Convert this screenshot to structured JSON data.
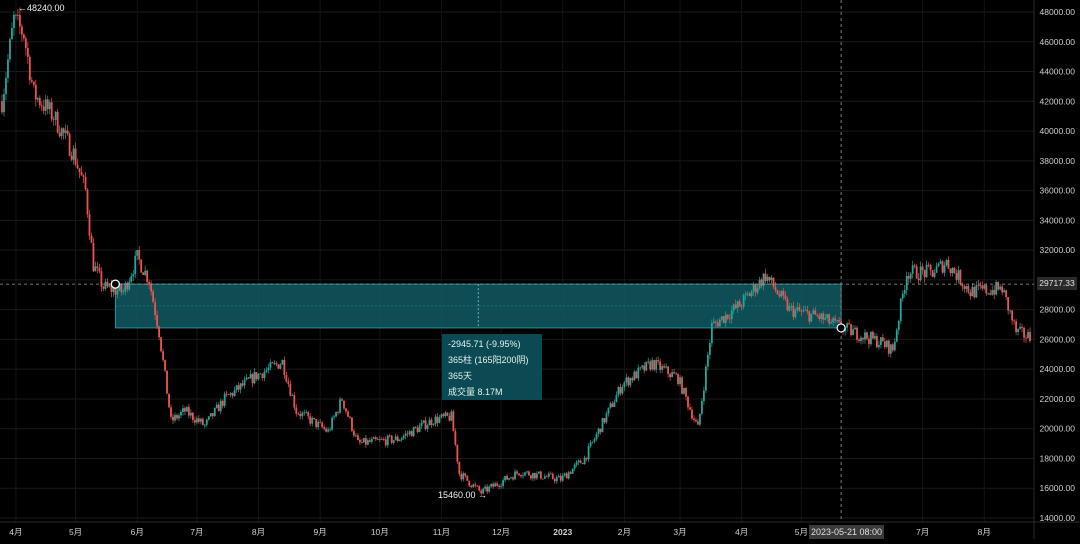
{
  "chart_data": {
    "type": "candlestick",
    "y_axis": {
      "ticks": [
        "48000.00",
        "46000.00",
        "44000.00",
        "42000.00",
        "40000.00",
        "38000.00",
        "36000.00",
        "34000.00",
        "32000.00",
        "30000.00",
        "28000.00",
        "26000.00",
        "24000.00",
        "22000.00",
        "20000.00",
        "18000.00",
        "16000.00",
        "14000.00"
      ],
      "range": [
        14000,
        48000
      ]
    },
    "x_axis": {
      "ticks": [
        "4月",
        "5月",
        "6月",
        "7月",
        "8月",
        "9月",
        "10月",
        "11月",
        "12月",
        "2023",
        "2月",
        "3月",
        "4月",
        "5月",
        "7月",
        "8月"
      ]
    },
    "series": [
      {
        "values_approx": [
          [
            "2022-03-25",
            42000
          ],
          [
            "2022-03-31",
            47500
          ],
          [
            "2022-04-05",
            46500
          ],
          [
            "2022-04-10",
            42500
          ],
          [
            "2022-04-20",
            41000
          ],
          [
            "2022-04-30",
            38500
          ],
          [
            "2022-05-06",
            36000
          ],
          [
            "2022-05-10",
            31000
          ],
          [
            "2022-05-15",
            29500
          ],
          [
            "2022-05-25",
            29200
          ],
          [
            "2022-06-01",
            31500
          ],
          [
            "2022-06-07",
            30000
          ],
          [
            "2022-06-12",
            26500
          ],
          [
            "2022-06-18",
            20500
          ],
          [
            "2022-06-25",
            21200
          ],
          [
            "2022-07-05",
            20200
          ],
          [
            "2022-07-15",
            22000
          ],
          [
            "2022-07-30",
            23500
          ],
          [
            "2022-08-13",
            24500
          ],
          [
            "2022-08-20",
            21200
          ],
          [
            "2022-09-05",
            19800
          ],
          [
            "2022-09-12",
            22000
          ],
          [
            "2022-09-20",
            19000
          ],
          [
            "2022-10-10",
            19300
          ],
          [
            "2022-10-28",
            20600
          ],
          [
            "2022-11-06",
            20800
          ],
          [
            "2022-11-10",
            17000
          ],
          [
            "2022-11-21",
            15700
          ],
          [
            "2022-12-10",
            17100
          ],
          [
            "2022-12-31",
            16600
          ],
          [
            "2023-01-12",
            18000
          ],
          [
            "2023-01-31",
            23000
          ],
          [
            "2023-02-15",
            24400
          ],
          [
            "2023-02-28",
            23400
          ],
          [
            "2023-03-10",
            20000
          ],
          [
            "2023-03-17",
            26900
          ],
          [
            "2023-03-31",
            28300
          ],
          [
            "2023-04-13",
            30300
          ],
          [
            "2023-04-25",
            28000
          ],
          [
            "2023-05-10",
            27500
          ],
          [
            "2023-05-21",
            26800
          ],
          [
            "2023-06-10",
            25800
          ],
          [
            "2023-06-16",
            25300
          ],
          [
            "2023-06-23",
            30500
          ],
          [
            "2023-07-06",
            30500
          ],
          [
            "2023-07-13",
            31200
          ],
          [
            "2023-07-25",
            29200
          ],
          [
            "2023-08-10",
            29400
          ],
          [
            "2023-08-17",
            26500
          ],
          [
            "2023-08-25",
            26100
          ]
        ]
      }
    ],
    "measure": {
      "start_price": 29717.33,
      "stats_lines": [
        "-2945.71 (-9.95%)",
        "365柱 (165阳200阴)",
        "365天",
        "成交量 8.17M"
      ]
    },
    "extremes": {
      "high_label": "48240.00",
      "low_label": "15460.00"
    },
    "crosshair": {
      "price_label": "29717.33",
      "date_label": "2023-05-21 08:00"
    },
    "colors": {
      "up": "#26a69a",
      "down": "#ef5350",
      "range_fill": "#0f5a62",
      "range_border": "#2aa6ad",
      "axis_text": "#cfcfcf"
    },
    "grid": true
  }
}
